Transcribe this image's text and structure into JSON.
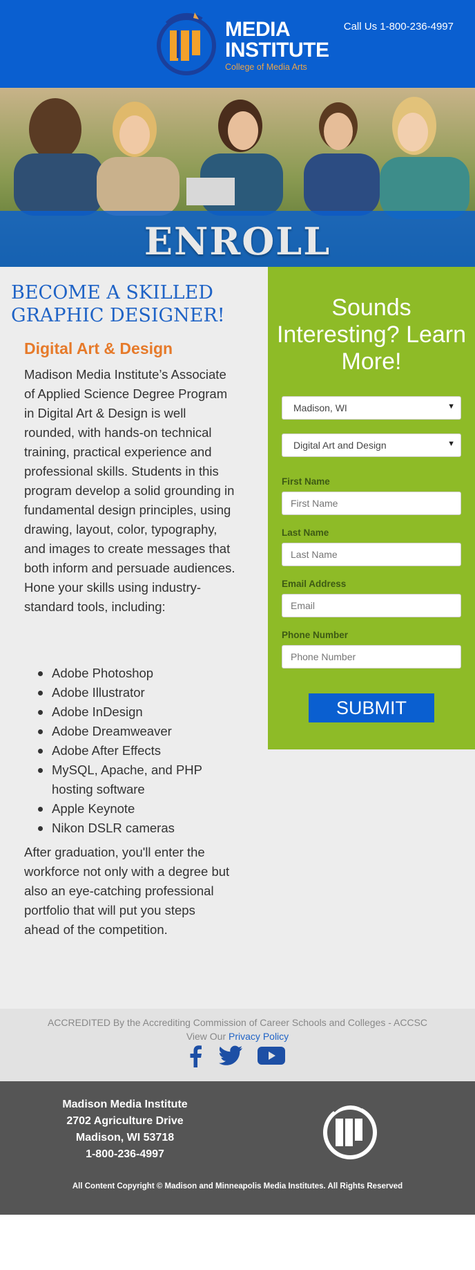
{
  "header": {
    "logo_line1": "MEDIA",
    "logo_line2": "INSTITUTE",
    "logo_sub": "College of Media Arts",
    "call": "Call Us 1-800-236-4997",
    "brand_color": "#0a5fd0"
  },
  "hero": {
    "title": "ENROLL"
  },
  "content": {
    "headline": "BECOME A SKILLED GRAPHIC DESIGNER!",
    "subhead": "Digital Art & Design",
    "intro": "Madison Media Institute’s Associate of Applied Science Degree Program in Digital Art & Design is well rounded, with hands-on technical training, practical experience and professional skills. Students in this program develop a solid grounding in fundamental design principles, using drawing, layout, color, typography, and images to create messages that both inform and persuade audiences. Hone your skills using industry-standard tools, including:",
    "tools": [
      "Adobe Photoshop",
      "Adobe Illustrator",
      "Adobe InDesign",
      "Adobe Dreamweaver",
      "Adobe After Effects",
      "MySQL, Apache, and PHP hosting software",
      "Apple Keynote",
      "Nikon DSLR cameras"
    ],
    "outro": "After graduation, you'll enter the workforce not only with a degree but also an eye-catching professional portfolio that will put you steps ahead of the competition."
  },
  "form": {
    "title": "Sounds Interesting? Learn More!",
    "campus_selected": "Madison, WI",
    "program_selected": "Digital Art and Design",
    "first_name_label": "First Name",
    "first_name_placeholder": "First Name",
    "last_name_label": "Last Name",
    "last_name_placeholder": "Last Name",
    "email_label": "Email Address",
    "email_placeholder": "Email",
    "phone_label": "Phone Number",
    "phone_placeholder": "Phone Number",
    "submit_label": "SUBMIT",
    "panel_color": "#8ebb27"
  },
  "accreditation": {
    "text": "ACCREDITED By the Accrediting Commission of Career Schools and Colleges - ACCSC",
    "privacy_prefix": "View Our ",
    "privacy_link": "Privacy Policy",
    "social_icons": [
      "facebook-icon",
      "twitter-icon",
      "youtube-icon"
    ]
  },
  "footer": {
    "name": "Madison Media Institute",
    "street": "2702 Agriculture Drive",
    "city": "Madison, WI 53718",
    "phone": "1-800-236-4997",
    "copyright": "All Content Copyright © Madison and Minneapolis Media Institutes. All Rights Reserved"
  }
}
